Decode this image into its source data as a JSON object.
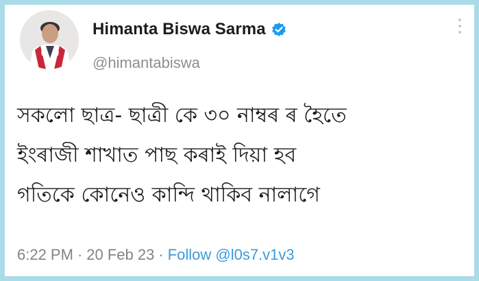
{
  "author": {
    "name": "Himanta Biswa Sarma",
    "handle": "@himantabiswa",
    "verified": true,
    "avatar_icon": "profile-photo"
  },
  "tweet": {
    "lines": [
      "সকলো ছাত্র- ছাত্ৰী কে ৩০ নাম্বৰ ৰ হৈতে",
      "ইংৰাজী শাখাত পাছ কৰাই  দিয়া হব",
      "গতিকে কোনেও কান্দি থাকিব নালাগে"
    ]
  },
  "meta": {
    "time": "6:22 PM",
    "separator": "·",
    "date": "20 Feb 23",
    "follow_label": "Follow @l0s7.v1v3"
  },
  "colors": {
    "frame": "#a9dbe9",
    "verified_badge": "#1d9bf0",
    "follow_link": "#3a9bd9"
  }
}
